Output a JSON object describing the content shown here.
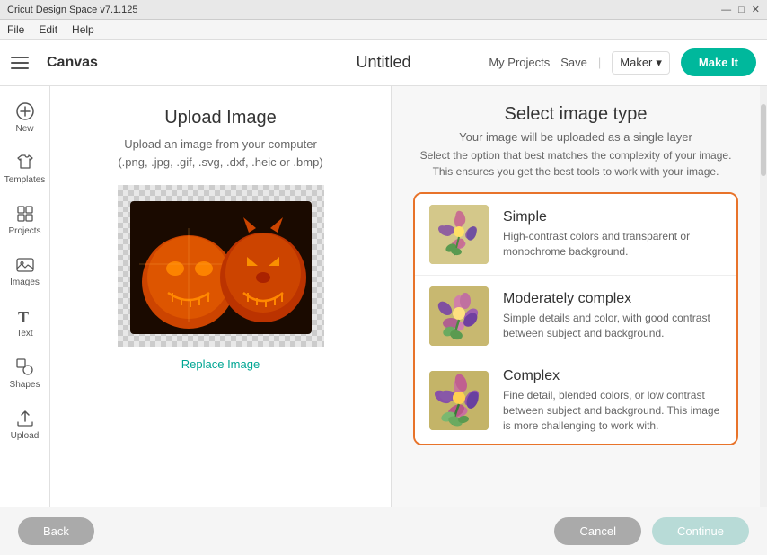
{
  "titlebar": {
    "title": "Cricut Design Space v7.1.125",
    "minimize": "—",
    "maximize": "□",
    "close": "✕"
  },
  "menubar": {
    "items": [
      "File",
      "Edit",
      "Help"
    ]
  },
  "header": {
    "canvas_label": "Canvas",
    "title": "Untitled",
    "my_projects": "My Projects",
    "save": "Save",
    "maker_label": "Maker",
    "make_it": "Make It"
  },
  "sidebar": {
    "items": [
      {
        "id": "new",
        "label": "New",
        "icon": "plus-circle"
      },
      {
        "id": "templates",
        "label": "Templates",
        "icon": "shirt"
      },
      {
        "id": "projects",
        "label": "Projects",
        "icon": "grid"
      },
      {
        "id": "images",
        "label": "Images",
        "icon": "image"
      },
      {
        "id": "text",
        "label": "Text",
        "icon": "text-t"
      },
      {
        "id": "shapes",
        "label": "Shapes",
        "icon": "shapes"
      },
      {
        "id": "upload",
        "label": "Upload",
        "icon": "upload"
      }
    ]
  },
  "upload": {
    "title": "Upload Image",
    "description_line1": "Upload an image from your computer",
    "description_line2": "(.png, .jpg, .gif, .svg, .dxf, .heic or .bmp)",
    "replace_link": "Replace Image"
  },
  "select": {
    "title": "Select image type",
    "subtitle": "Your image will be uploaded as a single layer",
    "description": "Select the option that best matches the complexity of your image.\nThis ensures you get the best tools to work with your image.",
    "options": [
      {
        "id": "simple",
        "name": "Simple",
        "description": "High-contrast colors and transparent or monochrome background."
      },
      {
        "id": "moderately-complex",
        "name": "Moderately complex",
        "description": "Simple details and color, with good contrast between subject and background."
      },
      {
        "id": "complex",
        "name": "Complex",
        "description": "Fine detail, blended colors, or low contrast between subject and background. This image is more challenging to work with."
      }
    ]
  },
  "footer": {
    "back": "Back",
    "cancel": "Cancel",
    "continue": "Continue"
  },
  "colors": {
    "accent": "#e8732a",
    "teal": "#00b89c",
    "teal_light": "#b8dbd7",
    "gray_btn": "#aaa"
  }
}
